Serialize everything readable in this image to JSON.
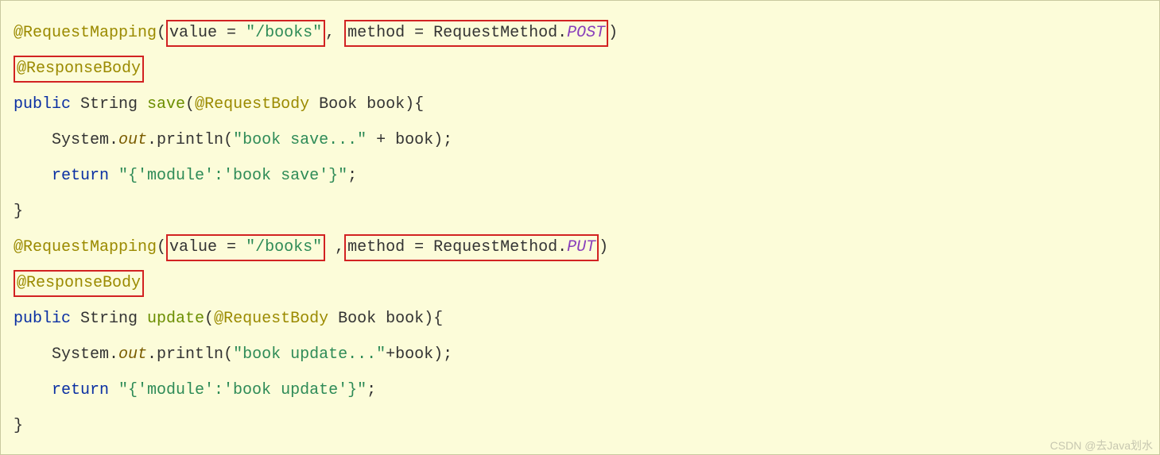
{
  "line1": {
    "ann": "@RequestMapping",
    "paren_open": "(",
    "box1_a": "value = ",
    "box1_b": "\"/books\"",
    "sep": ", ",
    "box2_a": "method = RequestMethod.",
    "box2_b": "POST",
    "paren_close": ")"
  },
  "line2": {
    "box": "@ResponseBody"
  },
  "line3": {
    "kw": "public ",
    "type": "String ",
    "method": "save",
    "paren_open": "(",
    "ann": "@RequestBody ",
    "argtype": "Book ",
    "argname": "book",
    "paren_close_brace": "){"
  },
  "line4": {
    "indent": "    ",
    "obj": "System.",
    "field": "out",
    "dot_method": ".println",
    "paren_open": "(",
    "str": "\"book save...\"",
    "plus": " + book);"
  },
  "line5": {
    "indent": "    ",
    "kw": "return ",
    "str": "\"{'module':'book save'}\"",
    "semi": ";"
  },
  "line6": {
    "brace": "}"
  },
  "line7": {
    "ann": "@RequestMapping",
    "paren_open": "(",
    "box1_a": "value = ",
    "box1_b": "\"/books\"",
    "sep": " ,",
    "box2_a": "method = RequestMethod.",
    "box2_b": "PUT",
    "paren_close": ")"
  },
  "line8": {
    "box": "@ResponseBody"
  },
  "line9": {
    "kw": "public ",
    "type": "String ",
    "method": "update",
    "paren_open": "(",
    "ann": "@RequestBody ",
    "argtype": "Book ",
    "argname": "book",
    "paren_close_brace": "){"
  },
  "line10": {
    "indent": "    ",
    "obj": "System.",
    "field": "out",
    "dot_method": ".println",
    "paren_open": "(",
    "str": "\"book update...\"",
    "plus": "+book);"
  },
  "line11": {
    "indent": "    ",
    "kw": "return ",
    "str": "\"{'module':'book update'}\"",
    "semi": ";"
  },
  "line12": {
    "brace": "}"
  },
  "watermark": "CSDN @去Java划水"
}
